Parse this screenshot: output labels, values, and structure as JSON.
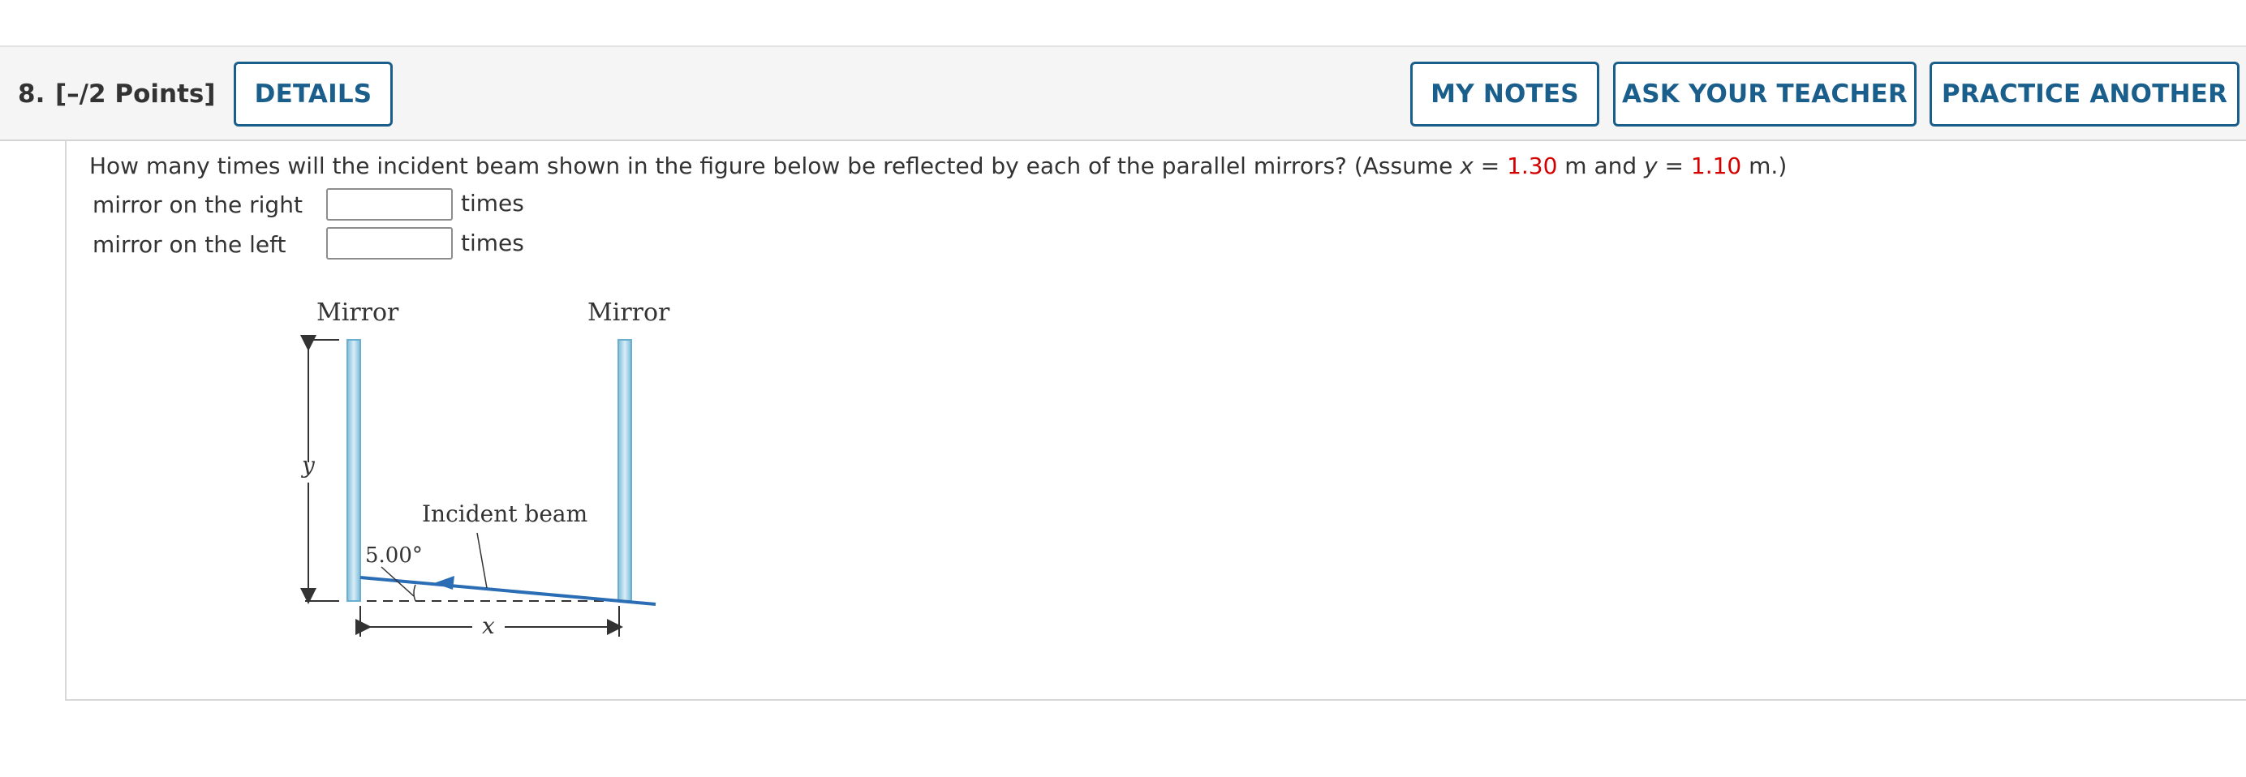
{
  "header": {
    "question_number": "8.",
    "points": "[–/2 Points]",
    "details_label": "DETAILS",
    "my_notes_label": "MY NOTES",
    "ask_teacher_label": "ASK YOUR TEACHER",
    "practice_another_label": "PRACTICE ANOTHER"
  },
  "question": {
    "text_before": "How many times will the incident beam shown in the figure below be reflected by each of the parallel mirrors? (Assume ",
    "var_x": "x",
    "eq1": " = ",
    "x_value": "1.30",
    "text_mid": " m and ",
    "var_y": "y",
    "eq2": " = ",
    "y_value": "1.10",
    "text_end": " m.)",
    "highlight_color": "#d40000"
  },
  "answers": [
    {
      "label": "mirror on the right",
      "value": "",
      "unit": "times"
    },
    {
      "label": "mirror on the left",
      "value": "",
      "unit": "times"
    }
  ],
  "figure": {
    "left_mirror_label": "Mirror",
    "right_mirror_label": "Mirror",
    "y_label": "y",
    "x_label": "x",
    "beam_label": "Incident beam",
    "angle_label": "5.00°",
    "mirror_color": "#a9d6ea",
    "beam_color": "#2a6db5"
  }
}
